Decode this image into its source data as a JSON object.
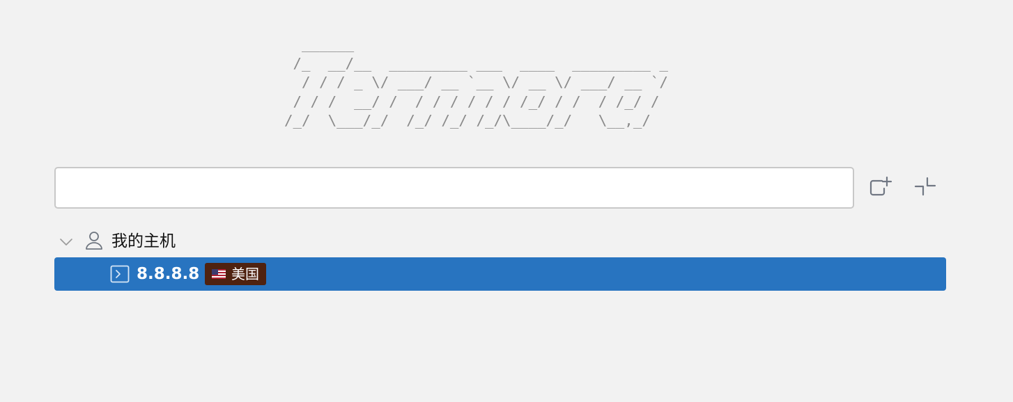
{
  "logo": {
    "ascii_art": "  ______\n /_  __/__  _________ ___  ____  _________ _\n  / / / _ \\/ ___/ __ `__ \\/ __ \\/ ___/ __ `/\n / / /  __/ /  / / / / / / /_/ / /  / /_/ /\n/_/  \\___/_/  /_/ /_/ /_/\\____/_/   \\__,_/"
  },
  "search": {
    "value": "",
    "placeholder": ""
  },
  "toolbar": {
    "new_tab_icon": "new-window-plus-icon",
    "collapse_icon": "collapse-icon"
  },
  "tree": {
    "group": {
      "label": "我的主机",
      "expanded": true,
      "icon": "user-icon"
    },
    "hosts": [
      {
        "label": "8.8.8.8",
        "icon": "terminal-icon",
        "selected": true,
        "badge": {
          "flag": "us-flag-icon",
          "label": "美国",
          "color": "#4f2210"
        }
      }
    ]
  },
  "colors": {
    "background": "#f2f2f2",
    "selection": "#2874c0",
    "badge": "#4f2210"
  }
}
